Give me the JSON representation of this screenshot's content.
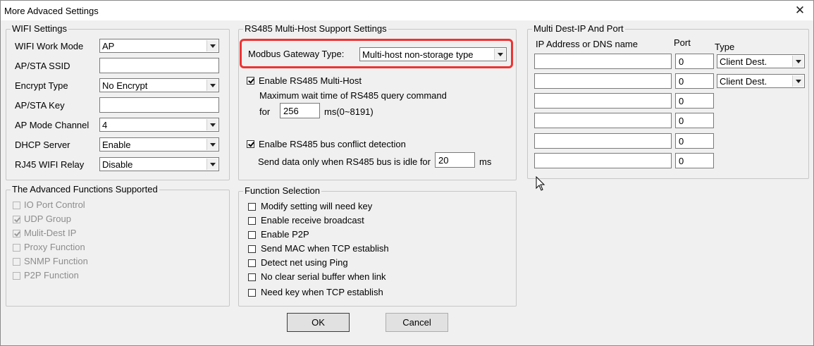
{
  "window": {
    "title": "More Advaced Settings"
  },
  "wifi": {
    "legend": "WIFI Settings",
    "work_mode_label": "WIFI Work Mode",
    "work_mode_value": "AP",
    "ssid_label": "AP/STA SSID",
    "ssid_value": "",
    "encrypt_label": "Encrypt Type",
    "encrypt_value": "No Encrypt",
    "key_label": "AP/STA Key",
    "key_value": "",
    "channel_label": "AP Mode Channel",
    "channel_value": "4",
    "dhcp_label": "DHCP Server",
    "dhcp_value": "Enable",
    "relay_label": "RJ45 WIFI Relay",
    "relay_value": "Disable"
  },
  "rs485": {
    "legend": "RS485 Multi-Host Support Settings",
    "gateway_label": "Modbus Gateway Type:",
    "gateway_value": "Multi-host non-storage type",
    "enable_multi_label": "Enable RS485 Multi-Host",
    "enable_multi_checked": true,
    "wait_text": "Maximum wait time of RS485  query command",
    "for_text": "for",
    "wait_value": "256",
    "wait_unit": "ms(0~8191)",
    "conflict_label": "Enalbe RS485 bus conflict detection",
    "conflict_checked": true,
    "idle_text": "Send data only when RS485 bus is idle for",
    "idle_value": "20",
    "idle_unit": "ms"
  },
  "multidest": {
    "legend": "Multi Dest-IP And Port",
    "col_ip": "IP Address or DNS name",
    "col_port": "Port",
    "col_type": "Type",
    "rows": [
      {
        "ip": "",
        "port": "0",
        "type": "Client Dest."
      },
      {
        "ip": "",
        "port": "0",
        "type": "Client Dest."
      },
      {
        "ip": "",
        "port": "0"
      },
      {
        "ip": "",
        "port": "0"
      },
      {
        "ip": "",
        "port": "0"
      },
      {
        "ip": "",
        "port": "0"
      }
    ]
  },
  "advanced": {
    "legend": "The Advanced Functions Supported",
    "items": [
      {
        "label": "IO Port Control",
        "checked": false
      },
      {
        "label": "UDP Group",
        "checked": true
      },
      {
        "label": "Mulit-Dest IP",
        "checked": true
      },
      {
        "label": "Proxy Function",
        "checked": false
      },
      {
        "label": "SNMP Function",
        "checked": false
      },
      {
        "label": "P2P Function",
        "checked": false
      }
    ]
  },
  "functions": {
    "legend": "Function Selection",
    "items": [
      {
        "label": "Modify setting will need key",
        "checked": false
      },
      {
        "label": "Enable receive broadcast",
        "checked": false
      },
      {
        "label": "Enable P2P",
        "checked": false
      },
      {
        "label": "Send MAC when TCP establish",
        "checked": false
      },
      {
        "label": "Detect net using Ping",
        "checked": false
      },
      {
        "label": "No clear serial buffer when link",
        "checked": false
      },
      {
        "label": "Need key when TCP establish",
        "checked": false
      }
    ]
  },
  "buttons": {
    "ok": "OK",
    "cancel": "Cancel"
  },
  "icons": {
    "close": "close-icon",
    "dropdown": "chevron-down-icon",
    "pointer": "mouse-pointer-icon"
  }
}
